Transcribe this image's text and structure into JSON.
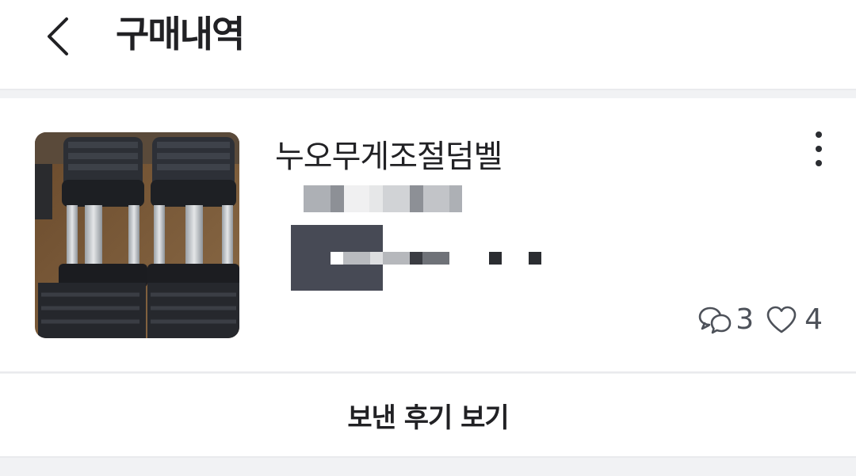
{
  "header": {
    "title": "구매내역"
  },
  "item": {
    "title": "누오무게조절덤벨",
    "image_alt": "adjustable dumbbells",
    "comment_count": "3",
    "like_count": "4"
  },
  "icons": {
    "back": "chevron-left-icon",
    "more": "more-vertical-icon",
    "comments": "chat-bubbles-icon",
    "likes": "heart-icon"
  },
  "actions": {
    "view_sent_review": "보낸 후기 보기"
  },
  "colors": {
    "text_primary": "#212124",
    "text_secondary": "#4d5159",
    "divider": "#e9eaed",
    "background": "#f1f2f4"
  }
}
